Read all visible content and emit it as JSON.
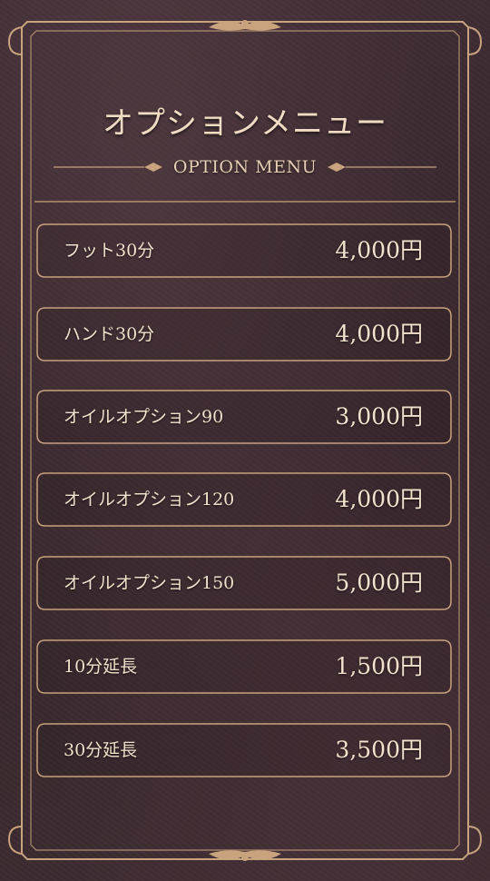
{
  "header": {
    "title": "オプションメニュー",
    "subtitle": "OPTION MENU"
  },
  "menu": {
    "items": [
      {
        "name": "フット30分",
        "price": "4,000円"
      },
      {
        "name": "ハンド30分",
        "price": "4,000円"
      },
      {
        "name": "オイルオプション90",
        "price": "3,000円"
      },
      {
        "name": "オイルオプション120",
        "price": "4,000円"
      },
      {
        "name": "オイルオプション150",
        "price": "5,000円"
      },
      {
        "name": "10分延長",
        "price": "1,500円"
      },
      {
        "name": "30分延長",
        "price": "3,500円"
      }
    ]
  },
  "colors": {
    "background": "#3a2a2e",
    "frame": "#c9a27e",
    "text": "#f2e2cd"
  }
}
